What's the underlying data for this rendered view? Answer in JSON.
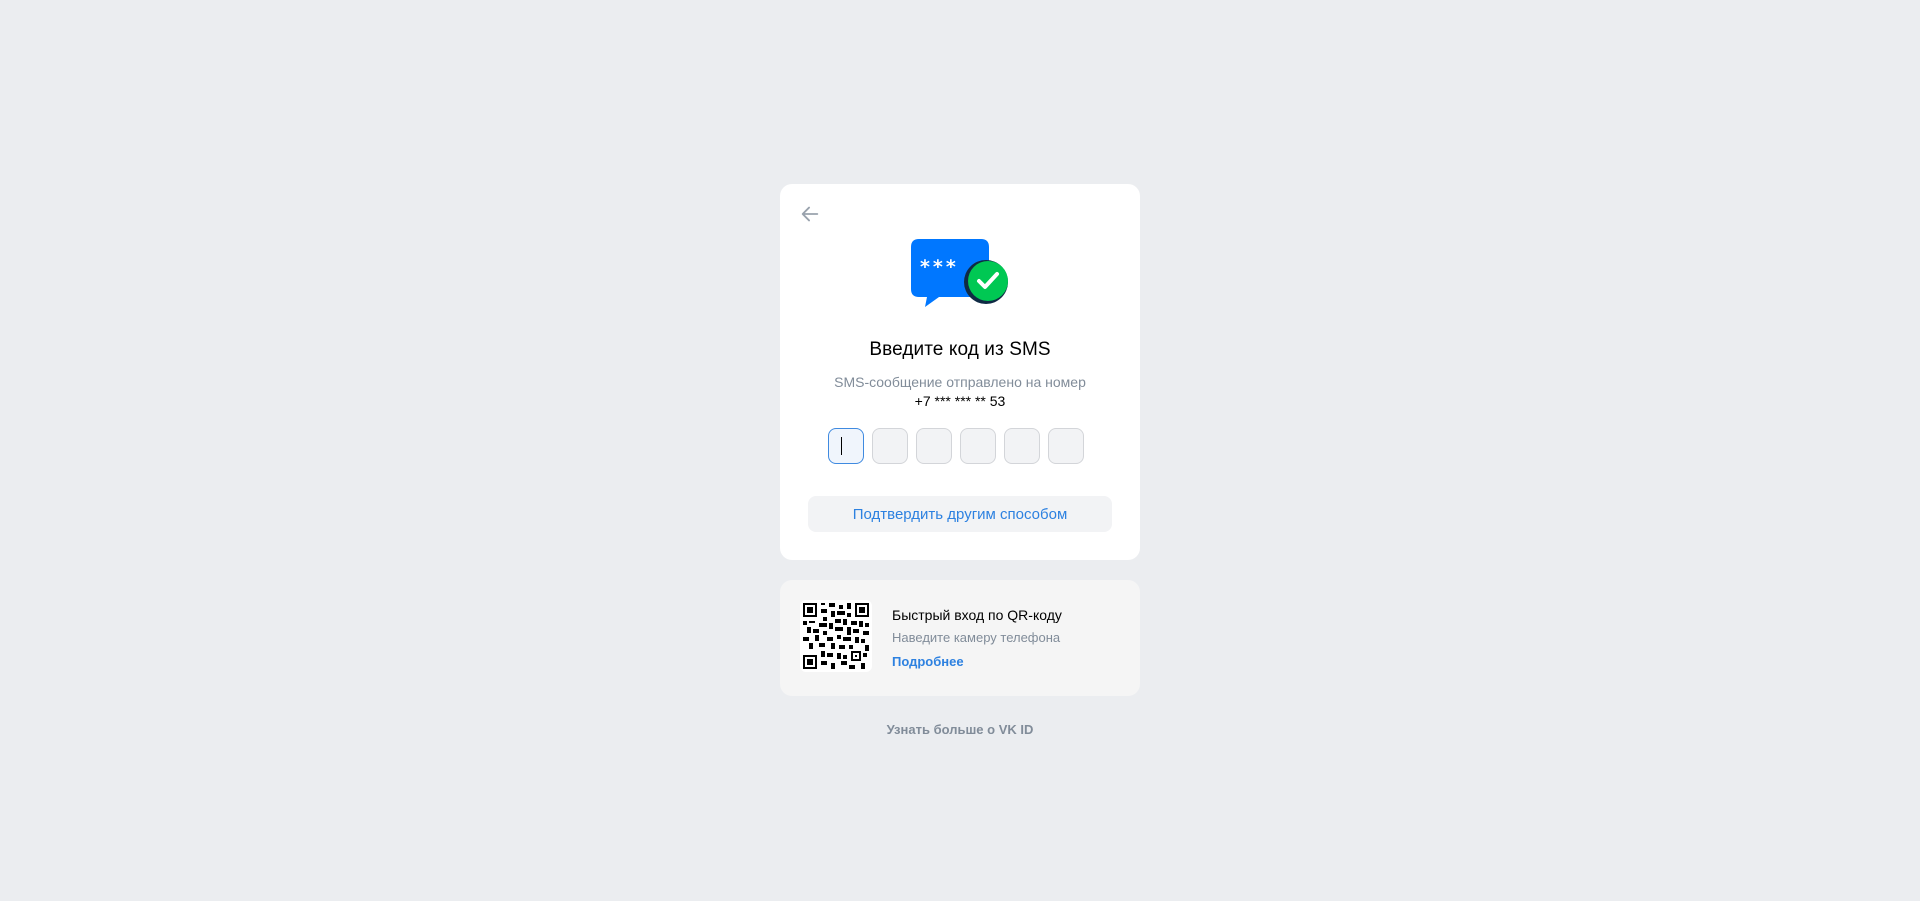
{
  "back_button": {
    "icon": "arrow-left-icon"
  },
  "illustration": {
    "icon": "sms-code-check-icon",
    "bubble_text": "***",
    "bubble_color": "#0077ff",
    "check_color": "#00c853"
  },
  "title": "Введите код из SMS",
  "subtitle": "SMS-сообщение отправлено на номер",
  "phone": "+7 *** *** ** 53",
  "code": {
    "cells": [
      "",
      "",
      "",
      "",
      "",
      ""
    ],
    "active_index": 0
  },
  "alt_button_label": "Подтвердить другим способом",
  "qr": {
    "title": "Быстрый вход по QR-коду",
    "subtitle": "Наведите камеру телефона",
    "link": "Подробнее",
    "icon": "qr-code-icon"
  },
  "footer_link": "Узнать больше о VK ID",
  "colors": {
    "background": "#ebedf0",
    "accent": "#2d81e0",
    "secondary_text": "#818c99"
  }
}
